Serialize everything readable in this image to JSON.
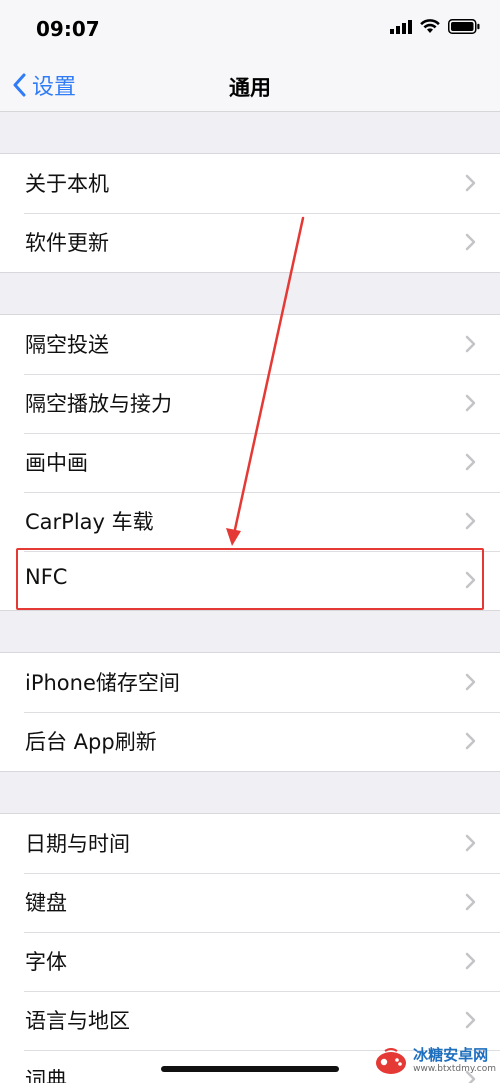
{
  "status_bar": {
    "time": "09:07",
    "icons": [
      "signal-icon",
      "wifi-icon",
      "battery-icon"
    ]
  },
  "nav": {
    "back_label": "设置",
    "title": "通用"
  },
  "groups": [
    {
      "items": [
        {
          "label": "关于本机"
        },
        {
          "label": "软件更新"
        }
      ]
    },
    {
      "items": [
        {
          "label": "隔空投送"
        },
        {
          "label": "隔空播放与接力"
        },
        {
          "label": "画中画"
        },
        {
          "label": "CarPlay 车载"
        },
        {
          "label": "NFC"
        }
      ]
    },
    {
      "items": [
        {
          "label": "iPhone储存空间"
        },
        {
          "label": "后台 App刷新"
        }
      ]
    },
    {
      "items": [
        {
          "label": "日期与时间"
        },
        {
          "label": "键盘"
        },
        {
          "label": "字体"
        },
        {
          "label": "语言与地区"
        },
        {
          "label": "词典"
        }
      ]
    }
  ],
  "annotation": {
    "highlighted_item": "NFC",
    "color": "#e53935"
  },
  "colors": {
    "accent": "#2f7cf6",
    "background": "#efeff4",
    "chevron": "#c4c4c8"
  },
  "watermark": {
    "title": "冰糖安卓网",
    "url": "www.btxtdmy.com"
  }
}
